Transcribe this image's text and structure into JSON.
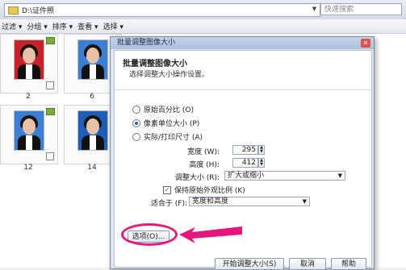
{
  "addressbar": {
    "path": "D:\\证件照"
  },
  "search": {
    "placeholder": "快速搜索"
  },
  "toolbar": {
    "items": [
      "过滤 ▾",
      "分组 ▾",
      "排序 ▾",
      "查看 ▾",
      "选择 ▾"
    ]
  },
  "thumbnails": [
    {
      "label": "2"
    },
    {
      "label": "6"
    },
    {
      "label": "12"
    },
    {
      "label": "14"
    }
  ],
  "dialog": {
    "title": "批量调整图像大小",
    "heading": "批量调整图像大小",
    "subheading": "选择调整大小操作设置。",
    "options": [
      "原始百分比 (O)",
      "像素单位大小 (P)",
      "实际/打印尺寸 (A)"
    ],
    "selected_option": 1,
    "width_label": "宽度 (W):",
    "width_value": "295",
    "height_label": "高度 (H):",
    "height_value": "412",
    "resize_label": "调整大小 (R):",
    "resize_value": "扩大或缩小",
    "keep_ratio_label": "保持原始外观比例 (K)",
    "keep_ratio_checked": true,
    "fit_label": "适合于 (F):",
    "fit_value": "宽度和高度",
    "options_button": "选项(O)...",
    "start_button": "开始调整大小(S)",
    "cancel_button": "取消",
    "help_button": "帮助"
  },
  "colors": {
    "highlight": "#e5177a",
    "dialog_bg": "#dbe4f1"
  }
}
